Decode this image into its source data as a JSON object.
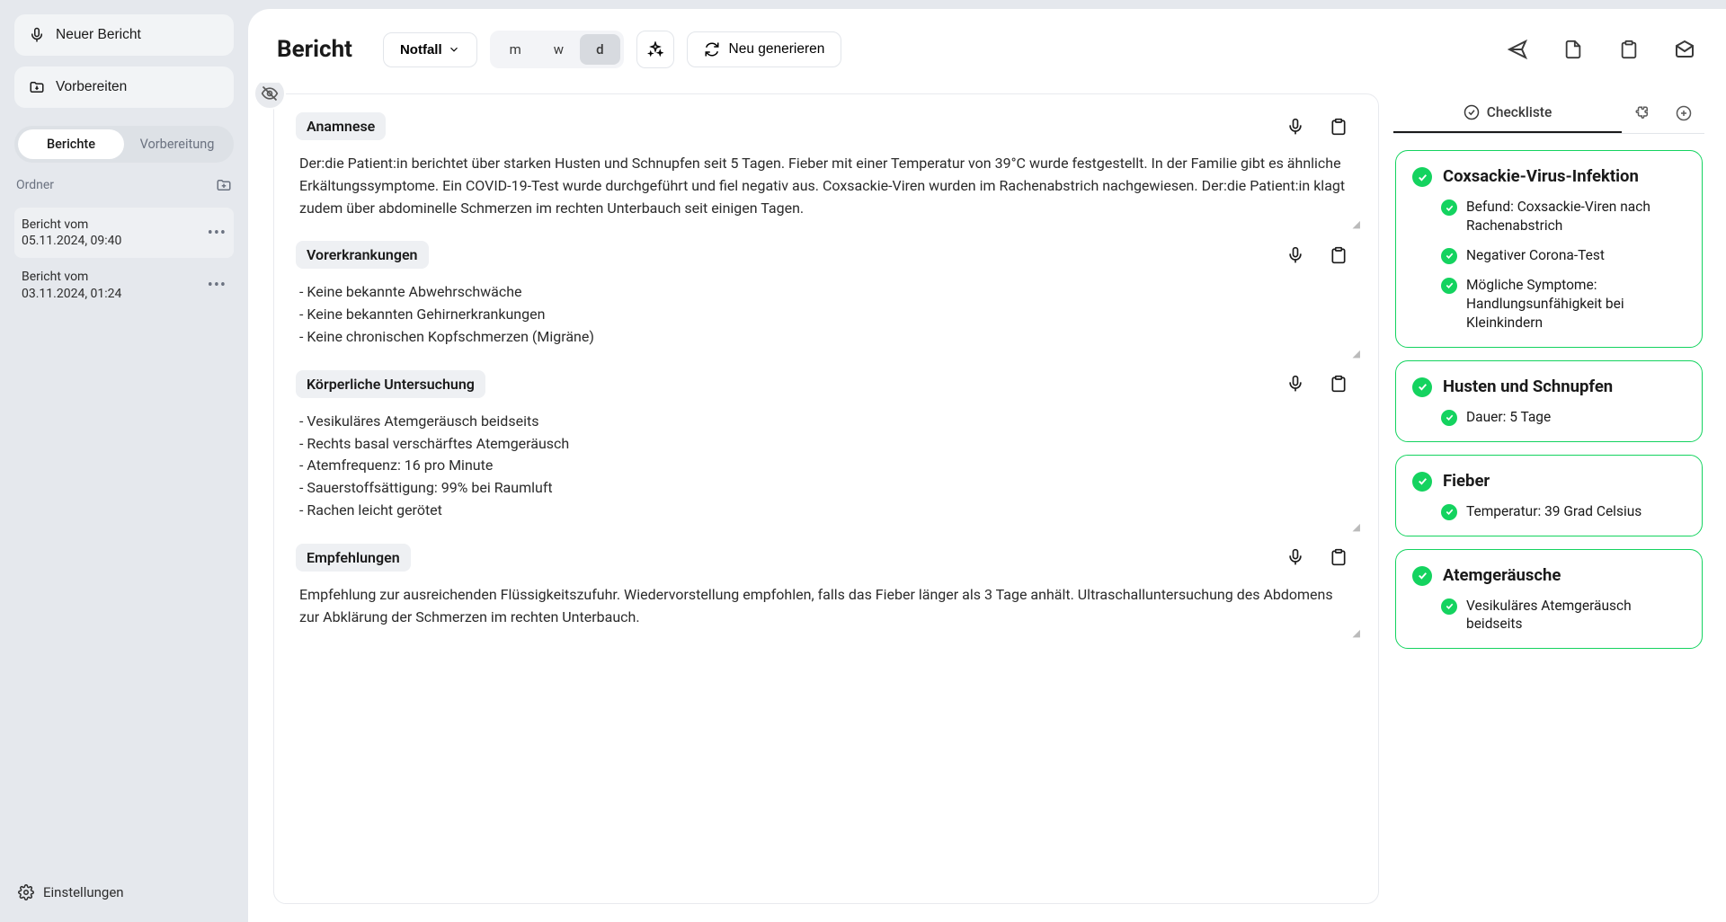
{
  "sidebar": {
    "new_report": "Neuer Bericht",
    "prepare": "Vorbereiten",
    "tabs": {
      "reports": "Berichte",
      "preparation": "Vorbereitung"
    },
    "folders_label": "Ordner",
    "reports": [
      {
        "title": "Bericht vom",
        "date": "05.11.2024, 09:40"
      },
      {
        "title": "Bericht vom",
        "date": "03.11.2024, 01:24"
      }
    ],
    "settings": "Einstellungen"
  },
  "header": {
    "title": "Bericht",
    "dropdown": "Notfall",
    "segments": [
      "m",
      "w",
      "d"
    ],
    "segment_active": 2,
    "regenerate": "Neu generieren"
  },
  "sections": [
    {
      "title": "Anamnese",
      "body": "Der:die Patient:in berichtet über starken Husten und Schnupfen seit 5 Tagen. Fieber mit einer Temperatur von 39°C wurde festgestellt. In der Familie gibt es ähnliche Erkältungssymptome. Ein COVID-19-Test wurde durchgeführt und fiel negativ aus. Coxsackie-Viren wurden im Rachenabstrich nachgewiesen. Der:die Patient:in klagt zudem über abdominelle Schmerzen im rechten Unterbauch seit einigen Tagen."
    },
    {
      "title": "Vorerkrankungen",
      "body": "- Keine bekannte Abwehrschwäche\n- Keine bekannten Gehirnerkrankungen\n- Keine chronischen Kopfschmerzen (Migräne)"
    },
    {
      "title": "Körperliche Untersuchung",
      "body": "- Vesikuläres Atemgeräusch beidseits\n- Rechts basal verschärftes Atemgeräusch\n- Atemfrequenz: 16 pro Minute\n- Sauerstoffsättigung: 99% bei Raumluft\n- Rachen leicht gerötet"
    },
    {
      "title": "Empfehlungen",
      "body": "Empfehlung zur ausreichenden Flüssigkeitszufuhr. Wiedervorstellung empfohlen, falls das Fieber länger als 3 Tage anhält. Ultraschalluntersuchung des Abdomens zur Abklärung der Schmerzen im rechten Unterbauch."
    }
  ],
  "checklist": {
    "tab_label": "Checkliste",
    "cards": [
      {
        "title": "Coxsackie-Virus-Infektion",
        "items": [
          "Befund: Coxsackie-Viren nach Rachenabstrich",
          "Negativer Corona-Test",
          "Mögliche Symptome: Handlungsunfähigkeit bei Kleinkindern"
        ]
      },
      {
        "title": "Husten und Schnupfen",
        "items": [
          "Dauer: 5 Tage"
        ]
      },
      {
        "title": "Fieber",
        "items": [
          "Temperatur: 39 Grad Celsius"
        ]
      },
      {
        "title": "Atemgeräusche",
        "items": [
          "Vesikuläres Atemgeräusch beidseits"
        ]
      }
    ]
  }
}
